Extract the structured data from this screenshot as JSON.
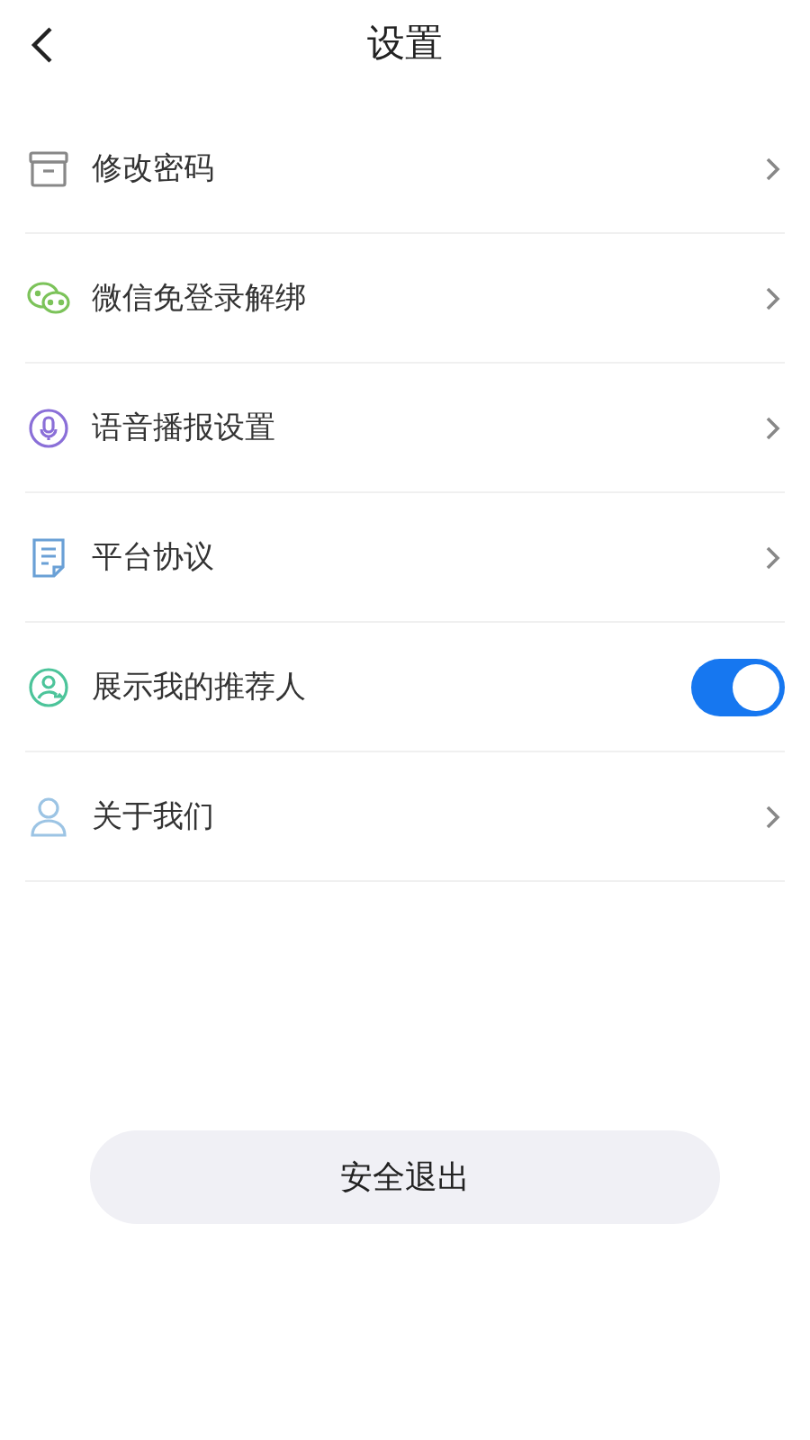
{
  "header": {
    "title": "设置"
  },
  "items": [
    {
      "label": "修改密码",
      "kind": "link"
    },
    {
      "label": "微信免登录解绑",
      "kind": "link"
    },
    {
      "label": "语音播报设置",
      "kind": "link"
    },
    {
      "label": "平台协议",
      "kind": "link"
    },
    {
      "label": "展示我的推荐人",
      "kind": "toggle",
      "on": true
    },
    {
      "label": "关于我们",
      "kind": "link"
    }
  ],
  "logout_button": {
    "label": "安全退出"
  }
}
